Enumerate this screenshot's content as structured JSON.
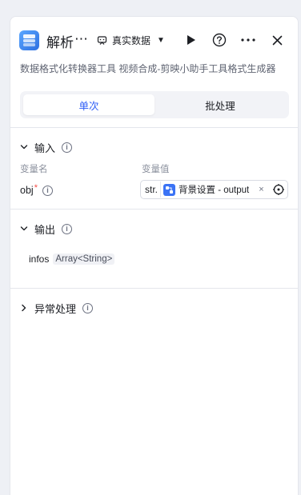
{
  "header": {
    "title": "解析",
    "title_overflow": "⋯",
    "mode_label": "真实数据",
    "mode_caret": "▼",
    "subtitle": "数据格式化转换器工具 视频合成-剪映小助手工具格式生成器"
  },
  "tabs": [
    {
      "label": "单次",
      "active": true
    },
    {
      "label": "批处理",
      "active": false
    }
  ],
  "input_section": {
    "title": "输入",
    "col_name": "变量名",
    "col_value": "变量值",
    "params": [
      {
        "name": "obj",
        "required_mark": "*",
        "type": "str.",
        "ref_label": "背景设置 - output",
        "remove": "×"
      }
    ]
  },
  "output_section": {
    "title": "输出",
    "fields": [
      {
        "name": "infos",
        "type": "Array<String>"
      }
    ]
  },
  "error_section": {
    "title": "异常处理"
  },
  "colors": {
    "accent": "#2b5bf6",
    "required": "#f54a45",
    "ref_icon": "#3b73f5"
  },
  "icons": [
    "tool-icon",
    "mode-icon",
    "run-icon",
    "help-icon",
    "more-icon",
    "close-icon",
    "info-icon",
    "chevron-down-icon",
    "chevron-right-icon",
    "target-icon"
  ]
}
